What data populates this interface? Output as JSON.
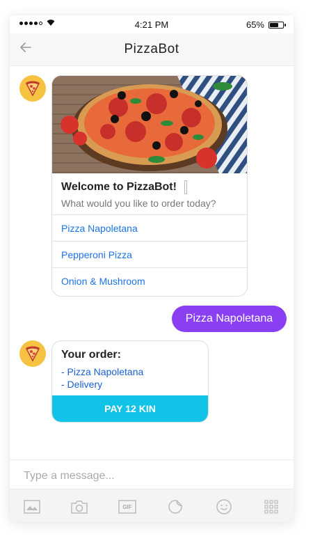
{
  "status_bar": {
    "time": "4:21 PM",
    "battery_text": "65%",
    "battery_level": 0.65
  },
  "header": {
    "title": "PizzaBot"
  },
  "welcome_card": {
    "title": "Welcome to PizzaBot!",
    "subtitle": "What would you like to order today?",
    "options": [
      "Pizza Napoletana",
      "Pepperoni Pizza",
      "Onion & Mushroom"
    ]
  },
  "user_message": "Pizza Napoletana",
  "order_card": {
    "title": "Your order:",
    "items": [
      "- Pizza Napoletana",
      "- Delivery"
    ],
    "pay_label": "PAY 12 KIN"
  },
  "composer": {
    "placeholder": "Type a message...",
    "value": ""
  },
  "toolbar": {
    "icons": [
      "image-icon",
      "camera-icon",
      "gif-icon",
      "sticker-icon",
      "emoji-icon",
      "grid-icon"
    ],
    "gif_label": "GIF"
  },
  "colors": {
    "accent_purple": "#8a3ff2",
    "pay_cyan": "#12c3e8",
    "link_blue": "#1a73e8",
    "avatar_yellow": "#f5c242"
  }
}
